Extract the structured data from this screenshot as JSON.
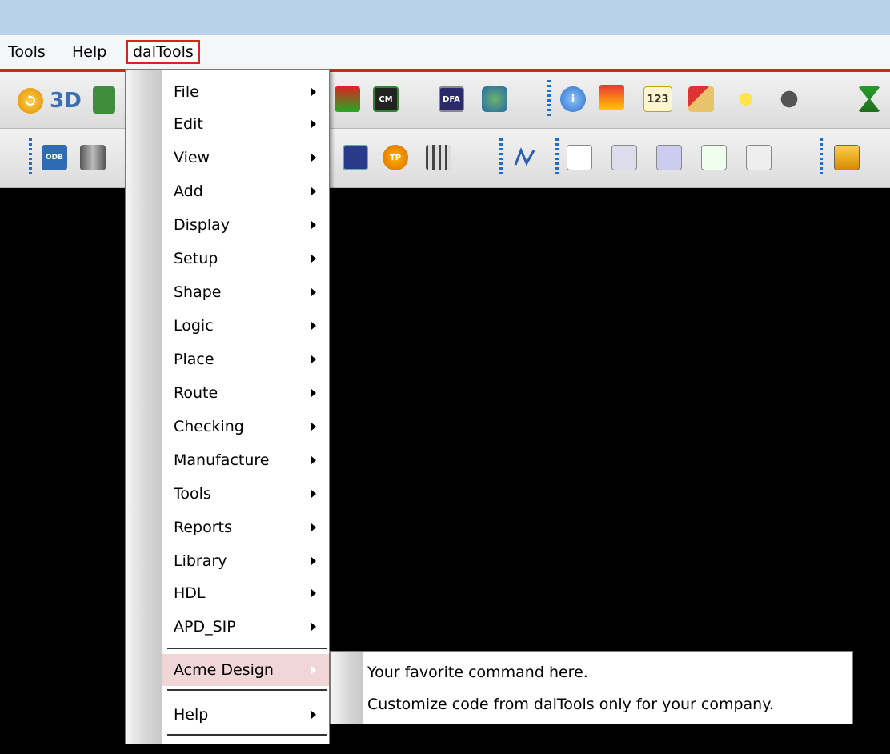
{
  "menubar": {
    "items": [
      {
        "label": "Tools"
      },
      {
        "label": "Help"
      },
      {
        "label": "dalTools"
      }
    ]
  },
  "toolbar1": {
    "icons": [
      "undo-icon",
      "3d-view-icon",
      "film-icon",
      "layers-icon",
      "cm-grid-icon",
      "dfa-grid-icon",
      "globe-icon",
      "info-icon",
      "bulb-icon",
      "ruler-123-icon",
      "broom-icon",
      "sun-icon",
      "bomb-icon",
      "hourglass-icon"
    ]
  },
  "toolbar2": {
    "icons": [
      "odb-export-icon",
      "cylinder-icon",
      "grid-dots-icon",
      "testpoint-icon",
      "pin-array-icon",
      "route-path-icon",
      "doc-signal-icon",
      "book-signal-icon",
      "calc-signal-icon",
      "check-signal-icon",
      "pen-signal-icon",
      "copy-windows-icon"
    ],
    "odb_label": "ODB",
    "tp_label": "TP",
    "cm_label": "CM",
    "dfa_label": "DFA",
    "num_label": "123"
  },
  "menu": {
    "items": [
      {
        "label": "File"
      },
      {
        "label": "Edit"
      },
      {
        "label": "View"
      },
      {
        "label": "Add"
      },
      {
        "label": "Display"
      },
      {
        "label": "Setup"
      },
      {
        "label": "Shape"
      },
      {
        "label": "Logic"
      },
      {
        "label": "Place"
      },
      {
        "label": "Route"
      },
      {
        "label": "Checking"
      },
      {
        "label": "Manufacture"
      },
      {
        "label": "Tools"
      },
      {
        "label": "Reports"
      },
      {
        "label": "Library"
      },
      {
        "label": "HDL"
      },
      {
        "label": "APD_SIP"
      }
    ],
    "acme": {
      "label": "Acme Design"
    },
    "help": {
      "label": "Help"
    }
  },
  "submenu": {
    "items": [
      {
        "label": "Your favorite command here."
      },
      {
        "label": "Customize code from dalTools only for your company."
      }
    ]
  },
  "colors": {
    "menubar_accent": "#d8241c",
    "highlight": "#f0d6d6",
    "title_bar": "#b9d1ea",
    "canvas": "#000000"
  }
}
